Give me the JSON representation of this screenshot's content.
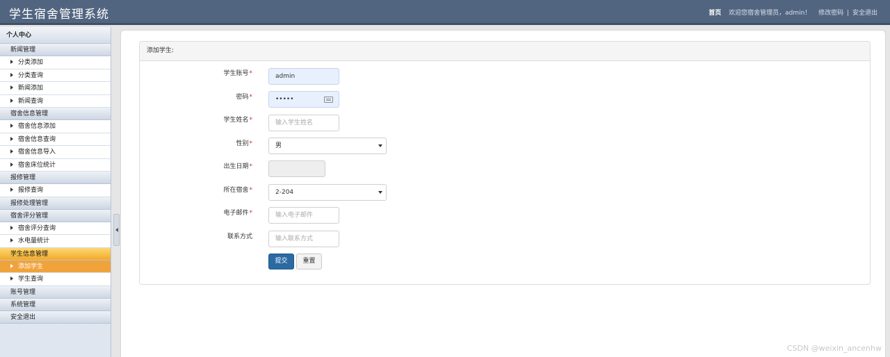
{
  "app": {
    "title": "学生宿舍管理系统"
  },
  "header": {
    "home": "首页",
    "welcome": "欢迎您宿舍管理员，admin！",
    "change_password": "修改密码",
    "separator": "|",
    "logout": "安全退出"
  },
  "sidebar": {
    "title": "个人中心",
    "groups": [
      {
        "label": "新闻管理",
        "items": [
          "分类添加",
          "分类查询",
          "新闻添加",
          "新闻查询"
        ]
      },
      {
        "label": "宿舍信息管理",
        "items": [
          "宿舍信息添加",
          "宿舍信息查询",
          "宿舍信息导入",
          "宿舍床位统计"
        ]
      },
      {
        "label": "报修管理",
        "items": [
          "报修查询"
        ]
      },
      {
        "label": "报修处理管理",
        "items": []
      },
      {
        "label": "宿舍评分管理",
        "items": [
          "宿舍评分查询",
          "水电量统计"
        ]
      },
      {
        "label": "学生信息管理",
        "items": [
          "添加学生",
          "学生查询"
        ]
      },
      {
        "label": "账号管理",
        "items": []
      },
      {
        "label": "系统管理",
        "items": []
      },
      {
        "label": "安全退出",
        "items": []
      }
    ]
  },
  "form": {
    "panel_title": "添加学生:",
    "required_mark": "*",
    "fields": {
      "account": {
        "label": "学生账号",
        "value": "admin"
      },
      "password": {
        "label": "密码",
        "value": "•••••"
      },
      "name": {
        "label": "学生姓名",
        "placeholder": "输入学生姓名"
      },
      "gender": {
        "label": "性别",
        "value": "男"
      },
      "birthdate": {
        "label": "出生日期",
        "value": ""
      },
      "dorm": {
        "label": "所在宿舍",
        "value": "2-204"
      },
      "email": {
        "label": "电子邮件",
        "placeholder": "输入电子邮件"
      },
      "contact": {
        "label": "联系方式",
        "placeholder": "输入联系方式"
      }
    },
    "submit": "提交",
    "reset": "重置"
  },
  "watermark": "CSDN @weixin_ancenhw",
  "colors": {
    "header": "#526580",
    "primary": "#2b6aa3",
    "active": "#f0a33b"
  }
}
